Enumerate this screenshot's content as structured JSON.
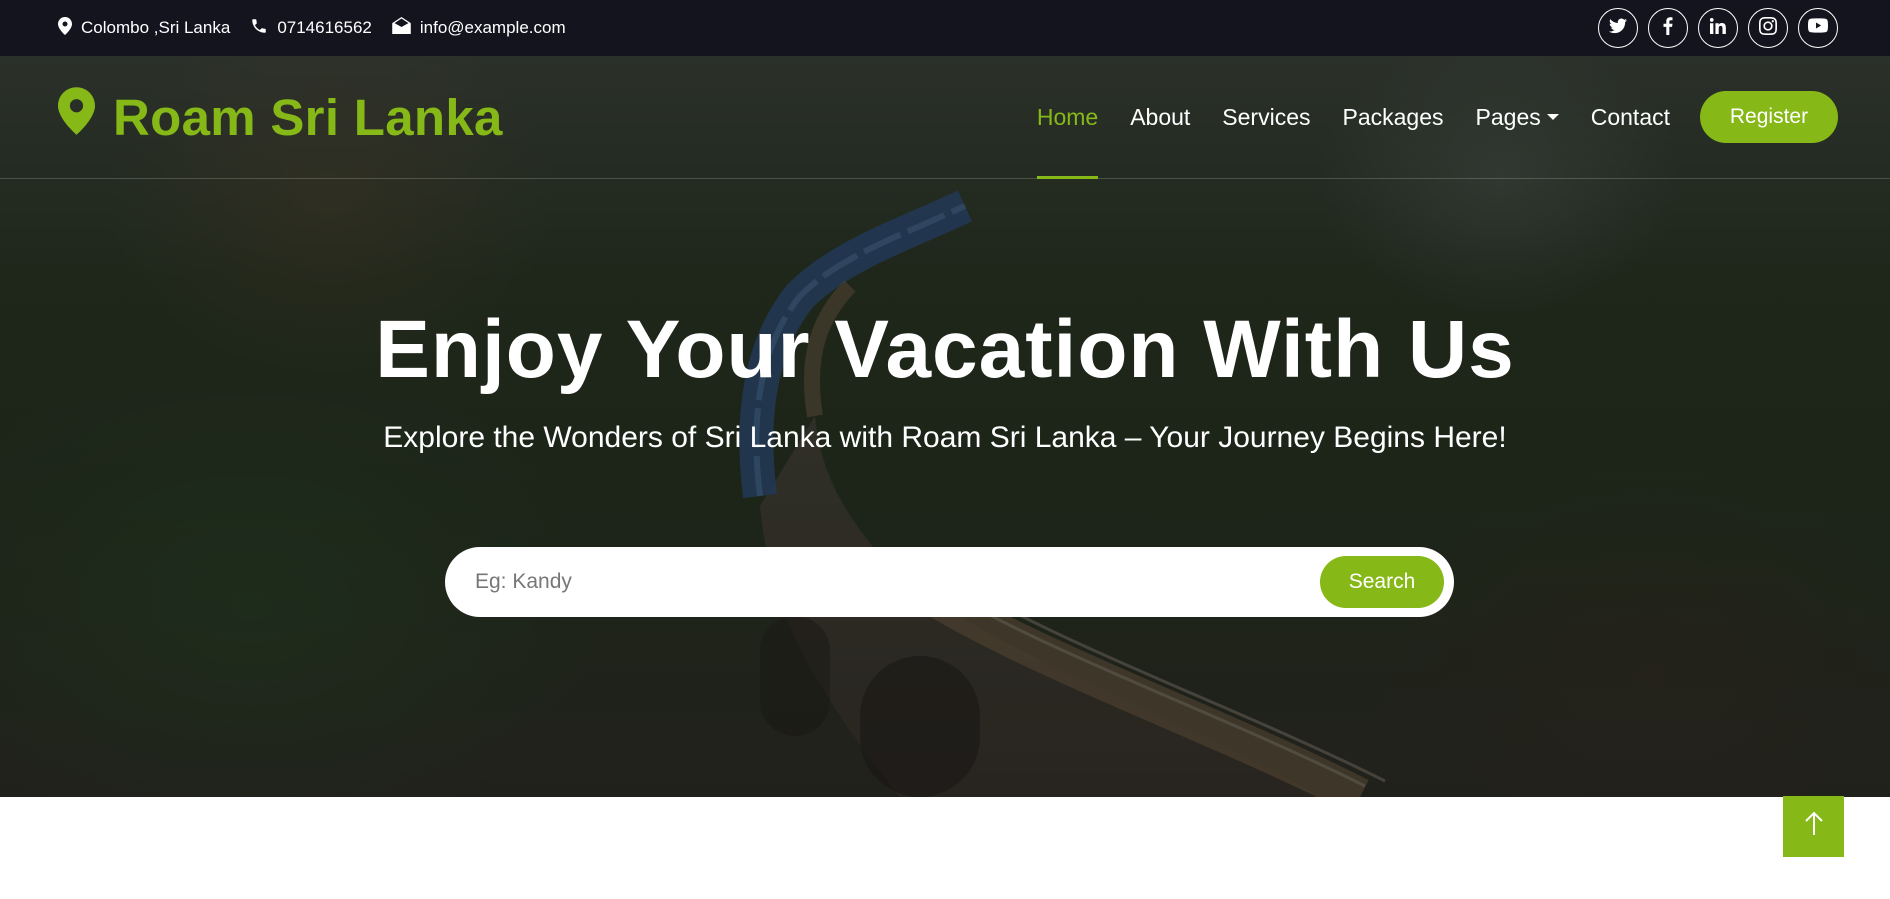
{
  "topbar": {
    "location": "Colombo ,Sri Lanka",
    "phone": "0714616562",
    "email": "info@example.com",
    "socials": [
      "twitter-icon",
      "facebook-icon",
      "linkedin-icon",
      "instagram-icon",
      "youtube-icon"
    ]
  },
  "navbar": {
    "brand": "Roam Sri Lanka",
    "brand_icon": "map-marker-icon",
    "items": [
      {
        "label": "Home",
        "active": true
      },
      {
        "label": "About"
      },
      {
        "label": "Services"
      },
      {
        "label": "Packages"
      },
      {
        "label": "Pages",
        "dropdown": true
      },
      {
        "label": "Contact"
      }
    ],
    "register_label": "Register"
  },
  "hero": {
    "title": "Enjoy Your Vacation With Us",
    "subtitle": "Explore the Wonders of Sri Lanka with Roam Sri Lanka – Your Journey Begins Here!",
    "search": {
      "placeholder": "Eg: Kandy",
      "value": "",
      "button_label": "Search"
    }
  },
  "colors": {
    "accent": "#86b817",
    "topbar_bg": "#14141f"
  },
  "back_to_top_icon": "arrow-up-icon"
}
